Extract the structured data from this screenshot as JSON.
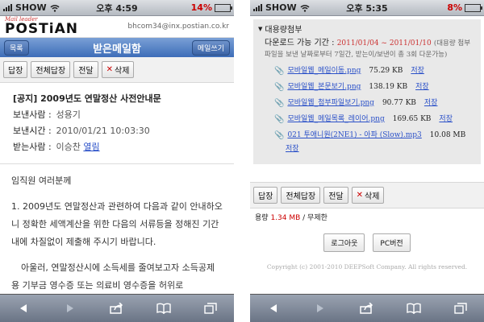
{
  "left": {
    "status": {
      "carrier": "SHOW",
      "time": "오후 4:59",
      "battery": "14%",
      "battery_level": 0.14
    },
    "brand": {
      "tagline": "Mail leader",
      "logo": "POSTiAN",
      "email": "bhcom34@inx.postian.co.kr"
    },
    "nav": {
      "back": "목록",
      "title": "받은메일함",
      "compose": "메일쓰기"
    },
    "toolbar": {
      "reply": "답장",
      "reply_all": "전체답장",
      "forward": "전달",
      "delete": "삭제"
    },
    "meta": {
      "subject": "[공지] 2009년도 연말정산 사전안내문",
      "sender_label": "보낸사람 :",
      "sender": "성용기",
      "sent_label": "보낸시간 :",
      "sent": "2010/01/21 10:03:30",
      "recipient_label": "받는사람 :",
      "recipient": "이승찬",
      "recipient_link": "열림"
    },
    "body": {
      "greeting": "임직원 여러분께",
      "p1": "1. 2009년도 연말정산과 관련하여 다음과 같이 안내하오니 정확한 세액계산을 위한 다음의 서류등을 정해진 기간 내에 차질없이 제출해 주시기 바랍니다.",
      "p2": "아울러, 연말정산시에 소득세를 줄여보고자 소득공제용 기부금 영수증 또는 의료비 영수증을 허위로"
    }
  },
  "right": {
    "status": {
      "carrier": "SHOW",
      "time": "오후 5:35",
      "battery": "8%",
      "battery_level": 0.08
    },
    "attach": {
      "title": "대용량첨부",
      "period_label": "다운로드 가능 기간 :",
      "period_dates": "2011/01/04 ~ 2011/01/10",
      "period_note": "(대용량 첨부파일을 보낸 날짜로부터 7일간, 받는이/보낸이 총 3회 다운가능)",
      "files": [
        {
          "name": "모바일웹_메일이동.png",
          "size": "75.29 KB",
          "save": "저장"
        },
        {
          "name": "모바일웹_본문보기.png",
          "size": "138.19 KB",
          "save": "저장"
        },
        {
          "name": "모바일웹_첨부파일보기.png",
          "size": "90.77 KB",
          "save": "저장"
        },
        {
          "name": "모바일웹_메일목록_레이어.png",
          "size": "169.65 KB",
          "save": "저장"
        },
        {
          "name": "021 투애니원(2NE1) - 아파 (Slow).mp3",
          "size": "10.08 MB",
          "save": "저장"
        }
      ]
    },
    "toolbar": {
      "reply": "답장",
      "reply_all": "전체답장",
      "forward": "전달",
      "delete": "삭제"
    },
    "footer": {
      "usage_label": "용량",
      "used": "1.34 MB",
      "unlimited": "/ 무제한",
      "logout": "로그아웃",
      "pc_version": "PC버전",
      "copyright": "Copyright (c) 2001-2010 DEEPSoft Company. All rights reserved."
    }
  },
  "icons": [
    "wifi-icon",
    "back-icon",
    "forward-icon",
    "share-icon",
    "bookmarks-icon",
    "tabs-icon",
    "paperclip-icon",
    "delete-x-icon"
  ]
}
